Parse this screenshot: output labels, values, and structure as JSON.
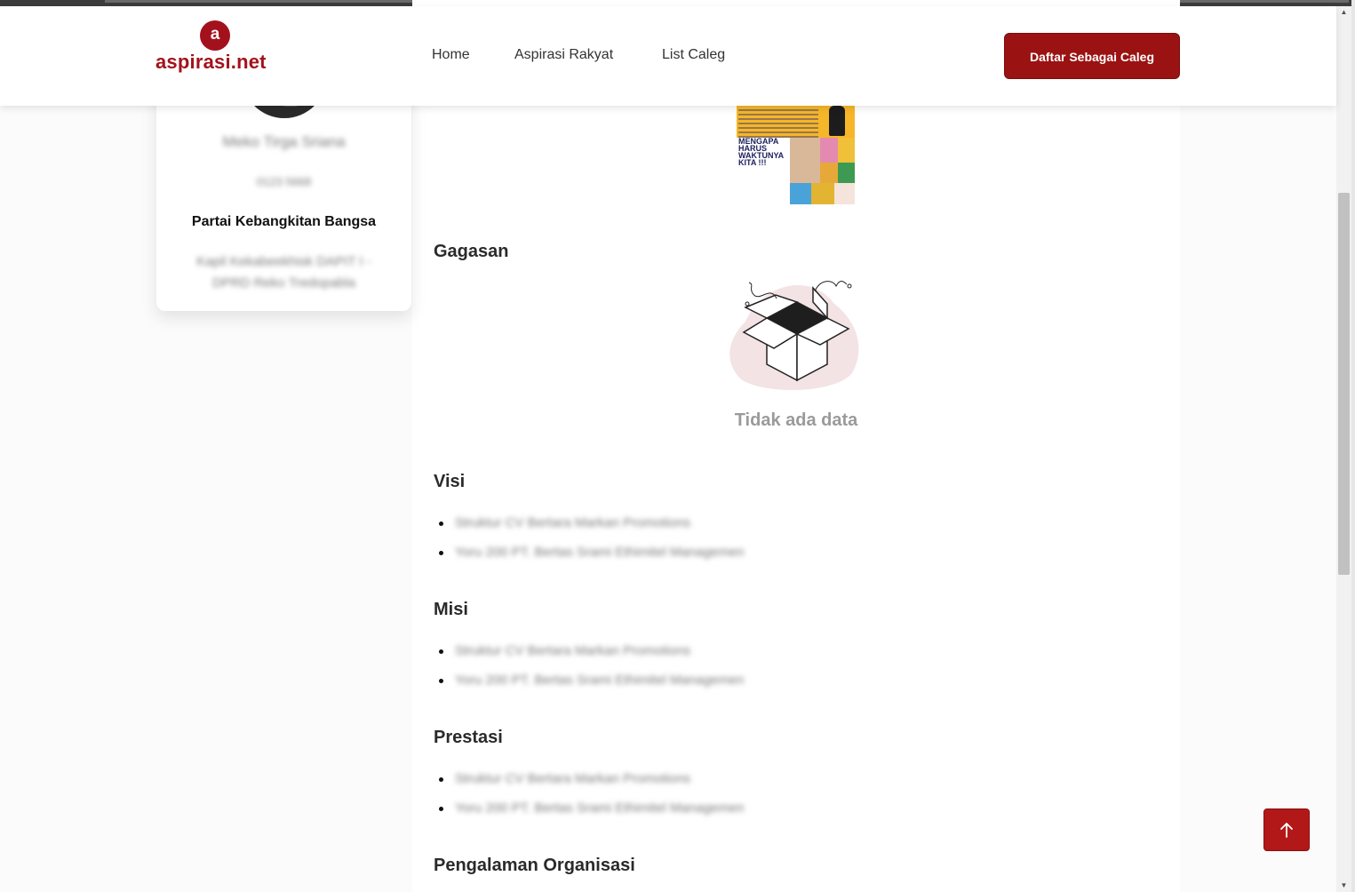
{
  "brand": {
    "logo_letter": "a",
    "name": "aspirasi.net",
    "color": "#a3121c"
  },
  "nav": {
    "links": [
      "Home",
      "Aspirasi Rakyat",
      "List Caleg"
    ],
    "cta_label": "Daftar Sebagai Caleg"
  },
  "profile": {
    "name": "Meko Tirga Sriana",
    "candidate_no": "0123 5668",
    "party": "Partai Kebangkitan Bangsa",
    "dapil": "Kapil Kekabeekhisk DAPIT I - DPRD Reko Tredopabla"
  },
  "poster": {
    "headline": [
      "MENGAPA",
      "HARUS",
      "WAKTUNYA",
      "KITA !!!"
    ]
  },
  "sections": {
    "gagasan": {
      "title": "Gagasan",
      "empty_text": "Tidak ada data"
    },
    "visi": {
      "title": "Visi",
      "items": [
        "Struktur CV Bertara Markan Promotions",
        "Yoru 200 PT. Bertas Srami Ethimitel Managemen"
      ]
    },
    "misi": {
      "title": "Misi",
      "items": [
        "Struktur CV Bertara Markan Promotions",
        "Yoru 200 PT. Bertas Srami Ethimitel Managemen"
      ]
    },
    "prestasi": {
      "title": "Prestasi",
      "items": [
        "Struktur CV Bertara Markan Promotions",
        "Yoru 200 PT. Bertas Srami Ethimitel Managemen"
      ]
    },
    "pengalaman": {
      "title": "Pengalaman Organisasi"
    }
  },
  "icons": {
    "scroll_top": "arrow-up-icon",
    "empty_state": "open-box-icon"
  },
  "colors": {
    "accent": "#9b1212",
    "empty_blob": "#f3e3e4"
  }
}
